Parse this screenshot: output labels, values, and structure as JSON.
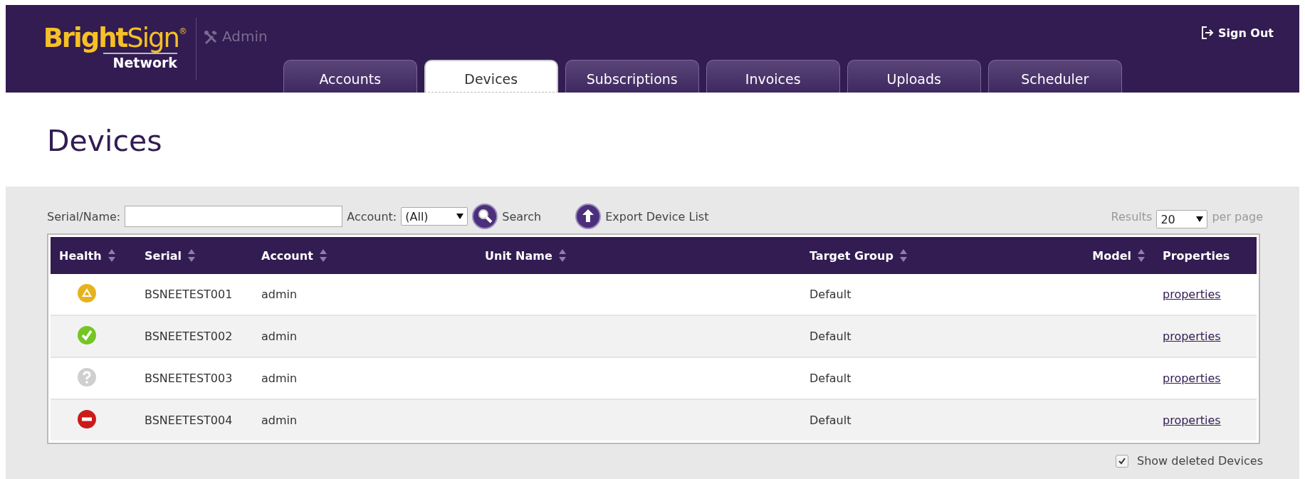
{
  "header": {
    "logo": "**Bright**Sign$^{®}$",
    "logo_sub": "Network",
    "section": "Admin",
    "sign_out": "Sign Out"
  },
  "tabs": [
    {
      "label": "Accounts",
      "selected": false
    },
    {
      "label": "Devices",
      "selected": true
    },
    {
      "label": "Subscriptions",
      "selected": false
    },
    {
      "label": "Invoices",
      "selected": false
    },
    {
      "label": "Uploads",
      "selected": false
    },
    {
      "label": "Scheduler",
      "selected": false
    }
  ],
  "page_title": "Devices",
  "filters": {
    "serial_label": "Serial/Name:",
    "account_label": "Account:",
    "account_value": "(All)",
    "search": "Search",
    "export": "Export Device List",
    "results_label": "Results",
    "per_page_value": "20",
    "per_page_label": "per page"
  },
  "table": {
    "columns": [
      {
        "label": "Health",
        "sortable": true
      },
      {
        "label": "Serial",
        "sortable": true
      },
      {
        "label": "Account",
        "sortable": true
      },
      {
        "label": "Unit Name",
        "sortable": true
      },
      {
        "label": "Target Group",
        "sortable": true
      },
      {
        "label": "Model",
        "sortable": true
      },
      {
        "label": "Properties",
        "sortable": false
      }
    ],
    "rows": [
      {
        "kind": "warning",
        "serial": "BSNEETEST001",
        "account": "admin",
        "target_group": "Default",
        "link": "properties"
      },
      {
        "kind": "ok",
        "serial": "BSNEETEST002",
        "account": "admin",
        "target_group": "Default",
        "link": "properties"
      },
      {
        "kind": "unknown",
        "serial": "BSNEETEST003",
        "account": "admin",
        "target_group": "Default",
        "link": "properties"
      },
      {
        "kind": "error",
        "serial": "BSNEETEST004",
        "account": "admin",
        "target_group": "Default",
        "link": "properties"
      }
    ]
  },
  "show_deleted": {
    "label": "Show deleted Devices",
    "checked": true
  }
}
